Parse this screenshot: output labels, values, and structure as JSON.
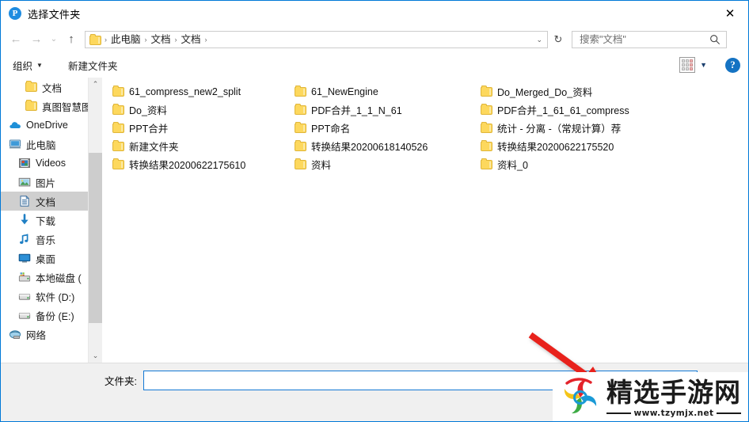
{
  "window": {
    "title": "选择文件夹",
    "app_icon": "P",
    "close_label": "✕",
    "accent_color": "#0078d7"
  },
  "nav": {
    "back_icon": "←",
    "forward_icon": "→",
    "recent_icon": "⌄",
    "up_icon": "↑",
    "refresh_icon": "↻",
    "dropdown_icon": "⌄",
    "breadcrumbs": [
      "此电脑",
      "文档",
      "文档"
    ],
    "separator": "›"
  },
  "search": {
    "placeholder": "搜索\"文档\"",
    "value": ""
  },
  "toolbar": {
    "organize_label": "组织",
    "organize_caret": "▼",
    "new_folder_label": "新建文件夹",
    "view_caret": "▼",
    "help_label": "?"
  },
  "sidebar": {
    "scroll_up_icon": "⌃",
    "scroll_down_icon": "⌄",
    "items": [
      {
        "label": "文档",
        "icon": "folder-icon",
        "indent": "ind-1",
        "selected": false
      },
      {
        "label": "真图智慧图",
        "icon": "folder-icon",
        "indent": "ind-1",
        "selected": false
      },
      {
        "label": "OneDrive",
        "icon": "cloud-icon",
        "indent": "ind-0",
        "selected": false
      },
      {
        "label": "此电脑",
        "icon": "computer-icon",
        "indent": "ind-0",
        "selected": false
      },
      {
        "label": "Videos",
        "icon": "videos-icon",
        "indent": "ind-2",
        "selected": false
      },
      {
        "label": "图片",
        "icon": "pictures-icon",
        "indent": "ind-2",
        "selected": false
      },
      {
        "label": "文档",
        "icon": "documents-icon",
        "indent": "ind-2",
        "selected": true
      },
      {
        "label": "下载",
        "icon": "downloads-icon",
        "indent": "ind-2",
        "selected": false
      },
      {
        "label": "音乐",
        "icon": "music-icon",
        "indent": "ind-2",
        "selected": false
      },
      {
        "label": "桌面",
        "icon": "desktop-icon",
        "indent": "ind-2",
        "selected": false
      },
      {
        "label": "本地磁盘 (",
        "icon": "system-drive-icon",
        "indent": "ind-2",
        "selected": false
      },
      {
        "label": "软件 (D:)",
        "icon": "drive-icon",
        "indent": "ind-2",
        "selected": false
      },
      {
        "label": "备份 (E:)",
        "icon": "drive-icon",
        "indent": "ind-2",
        "selected": false
      },
      {
        "label": "网络",
        "icon": "network-icon",
        "indent": "ind-0",
        "selected": false
      }
    ]
  },
  "filelist": {
    "columns": [
      [
        "61_compress_new2_split",
        "Do_资料",
        "PPT合并",
        "新建文件夹",
        "转换结果20200622175610"
      ],
      [
        "61_NewEngine",
        "PDF合并_1_1_N_61",
        "PPT命名",
        "转换结果20200618140526",
        "资料"
      ],
      [
        "Do_Merged_Do_资料",
        "PDF合并_1_61_61_compress",
        "统计 - 分离 -（常规计算）荐",
        "转换结果20200622175520",
        "资料_0"
      ]
    ]
  },
  "bottom": {
    "folder_label": "文件夹:",
    "folder_value": "",
    "folder_placeholder": ""
  },
  "annotation": {
    "arrow_color": "#e8221c"
  },
  "watermark": {
    "title": "精选手游网",
    "url": "www.tzymjx.net"
  }
}
